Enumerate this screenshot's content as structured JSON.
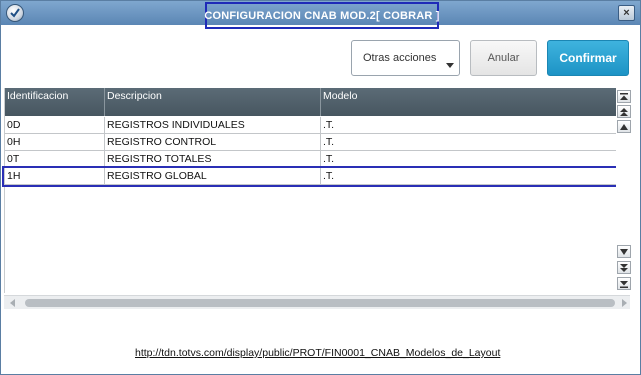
{
  "window": {
    "title": "CONFIGURACION CNAB MOD.2[ COBRAR ]",
    "close_symbol": "×",
    "app_icon": "totvs-logo-icon"
  },
  "toolbar": {
    "otras_label": "Otras acciones",
    "anular_label": "Anular",
    "confirmar_label": "Confirmar"
  },
  "table": {
    "columns": [
      "Identificacion",
      "Descripcion",
      "Modelo"
    ],
    "rows": [
      {
        "id": "0D",
        "desc": "REGISTROS INDIVIDUALES",
        "model": ".T."
      },
      {
        "id": "0H",
        "desc": "REGISTRO CONTROL",
        "model": ".T."
      },
      {
        "id": "0T",
        "desc": "REGISTRO TOTALES",
        "model": ".T."
      },
      {
        "id": "1H",
        "desc": "REGISTRO GLOBAL",
        "model": ".T."
      }
    ],
    "selected_row": 3
  },
  "footer": {
    "link": "http://tdn.totvs.com/display/public/PROT/FIN0001_CNAB_Modelos_de_Layout"
  },
  "colors": {
    "title_bar": "#6b95c2",
    "confirm_button": "#2aa3d3",
    "grid_header": "#4f5f6a",
    "highlight_outline": "#2a2fb5"
  }
}
